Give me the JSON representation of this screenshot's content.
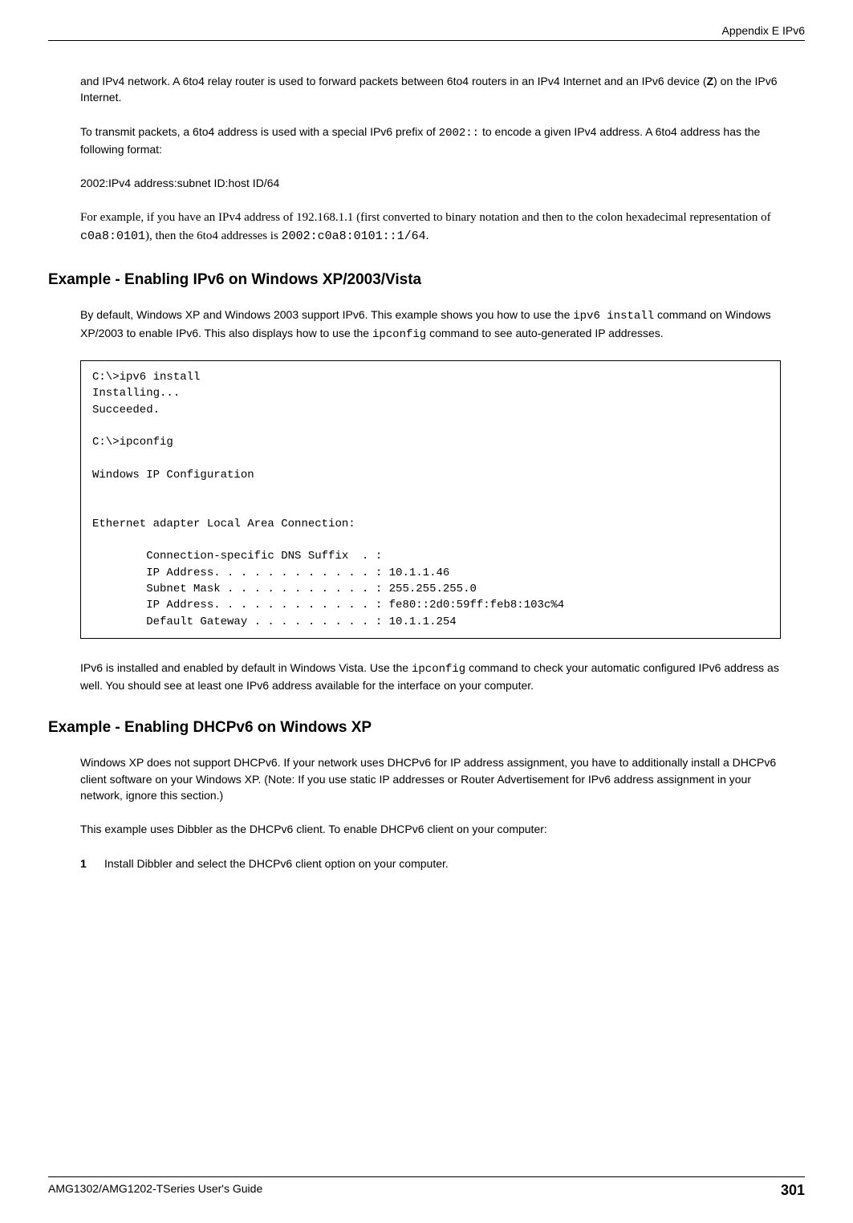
{
  "header": {
    "appendix": "Appendix E IPv6"
  },
  "content": {
    "p1_a": "and IPv4 network. A 6to4 relay router is used to forward packets between 6to4 routers in an IPv4 Internet and an IPv6 device (",
    "p1_b": "Z",
    "p1_c": ") on the IPv6 Internet.",
    "p2_a": "To transmit packets, a 6to4 address is used with a special IPv6 prefix of ",
    "p2_b": "2002::",
    "p2_c": " to encode a given IPv4 address. A 6to4 address has the following format:",
    "p3": "2002:IPv4 address:subnet ID:host ID/64",
    "p4_a": "For example, if you have an IPv4 address of 192.168.1.1 (first converted to binary notation and then to the colon hexadecimal representation of ",
    "p4_b": "c0a8:0101",
    "p4_c": "), then the 6to4 addresses is ",
    "p4_d": "2002:c0a8:0101::1/64",
    "p4_e": ".",
    "h1": "Example - Enabling IPv6 on Windows XP/2003/Vista",
    "p5_a": "By default, Windows XP and Windows 2003 support IPv6. This example shows you how to use the ",
    "p5_b": "ipv6 install",
    "p5_c": " command on Windows XP/2003 to enable IPv6. This also displays how to use the ",
    "p5_d": "ipconfig",
    "p5_e": " command to see auto-generated IP addresses.",
    "codebox1": "C:\\>ipv6 install\nInstalling...\nSucceeded.\n\nC:\\>ipconfig\n\nWindows IP Configuration\n\n\nEthernet adapter Local Area Connection:\n\n        Connection-specific DNS Suffix  . :\n        IP Address. . . . . . . . . . . . : 10.1.1.46\n        Subnet Mask . . . . . . . . . . . : 255.255.255.0\n        IP Address. . . . . . . . . . . . : fe80::2d0:59ff:feb8:103c%4\n        Default Gateway . . . . . . . . . : 10.1.1.254",
    "p6_a": "IPv6 is installed and enabled by default in Windows Vista. Use the ",
    "p6_b": "ipconfig",
    "p6_c": " command to check your automatic configured IPv6 address as well. You should see at least one IPv6 address available for the interface on your computer.",
    "h2": "Example - Enabling DHCPv6 on Windows XP",
    "p7": "Windows XP does not support DHCPv6. If your network uses DHCPv6 for IP address assignment, you have to additionally install a DHCPv6 client software on your Windows XP. (Note: If you use static IP addresses or Router Advertisement for IPv6 address assignment in your network, ignore this section.)",
    "p8": "This example uses Dibbler as the DHCPv6 client. To enable DHCPv6 client on your computer:",
    "step1_num": "1",
    "step1_text": "Install Dibbler and select the DHCPv6 client option on your computer."
  },
  "footer": {
    "guide": "AMG1302/AMG1202-TSeries User's Guide",
    "page": "301"
  }
}
